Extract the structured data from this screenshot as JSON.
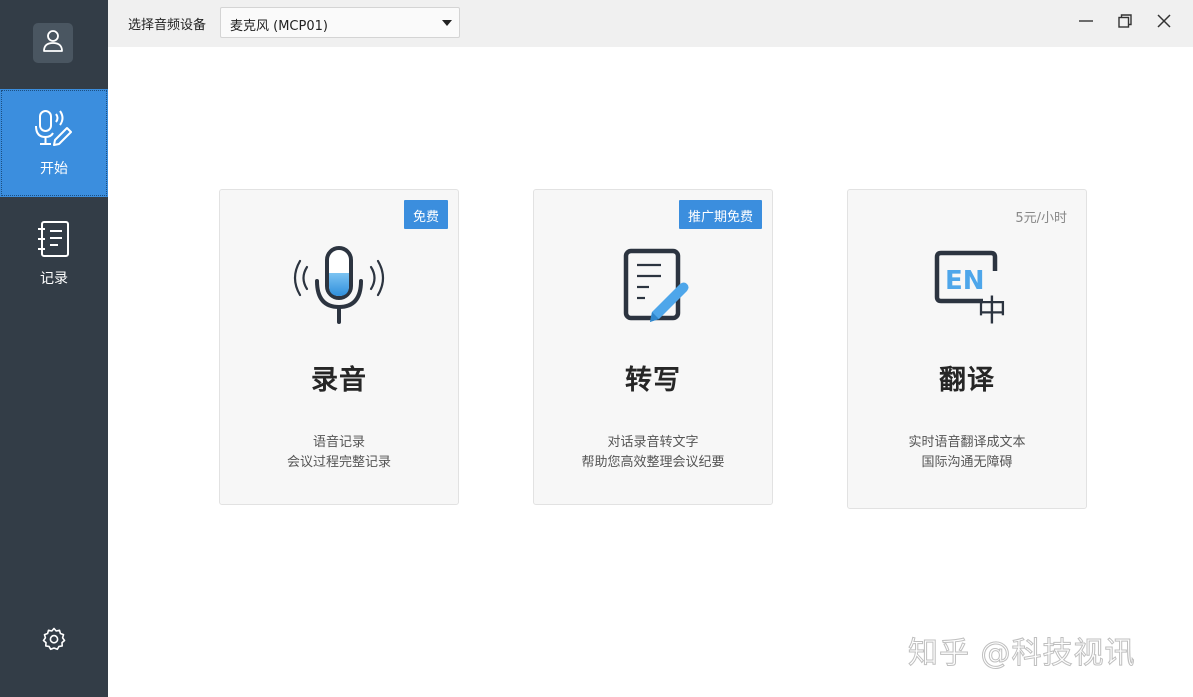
{
  "sidebar": {
    "avatar_icon": "user-icon",
    "items": [
      {
        "label": "开始",
        "icon": "mic-pen-icon",
        "active": true
      },
      {
        "label": "记录",
        "icon": "notebook-icon",
        "active": false
      }
    ],
    "settings_icon": "gear-icon"
  },
  "titlebar": {
    "device_label": "选择音频设备",
    "device_value": "麦克风 (MCP01)",
    "controls": [
      "minimize-icon",
      "restore-icon",
      "close-icon"
    ]
  },
  "cards": [
    {
      "title": "录音",
      "badge": "免费",
      "desc_line1": "语音记录",
      "desc_line2": "会议过程完整记录",
      "icon": "microphone-icon"
    },
    {
      "title": "转写",
      "badge": "推广期免费",
      "desc_line1": "对话录音转文字",
      "desc_line2": "帮助您高效整理会议纪要",
      "icon": "document-pen-icon"
    },
    {
      "title": "翻译",
      "price": "5元/小时",
      "desc_line1": "实时语音翻译成文本",
      "desc_line2": "国际沟通无障碍",
      "icon": "en-zh-translate-icon",
      "icon_text_en": "EN",
      "icon_text_zh": "中"
    }
  ],
  "watermark": "知乎 @科技视讯",
  "colors": {
    "sidebar": "#333d47",
    "accent": "#3b8ede",
    "titlebar": "#f0f0f0",
    "card": "#f7f7f7"
  }
}
